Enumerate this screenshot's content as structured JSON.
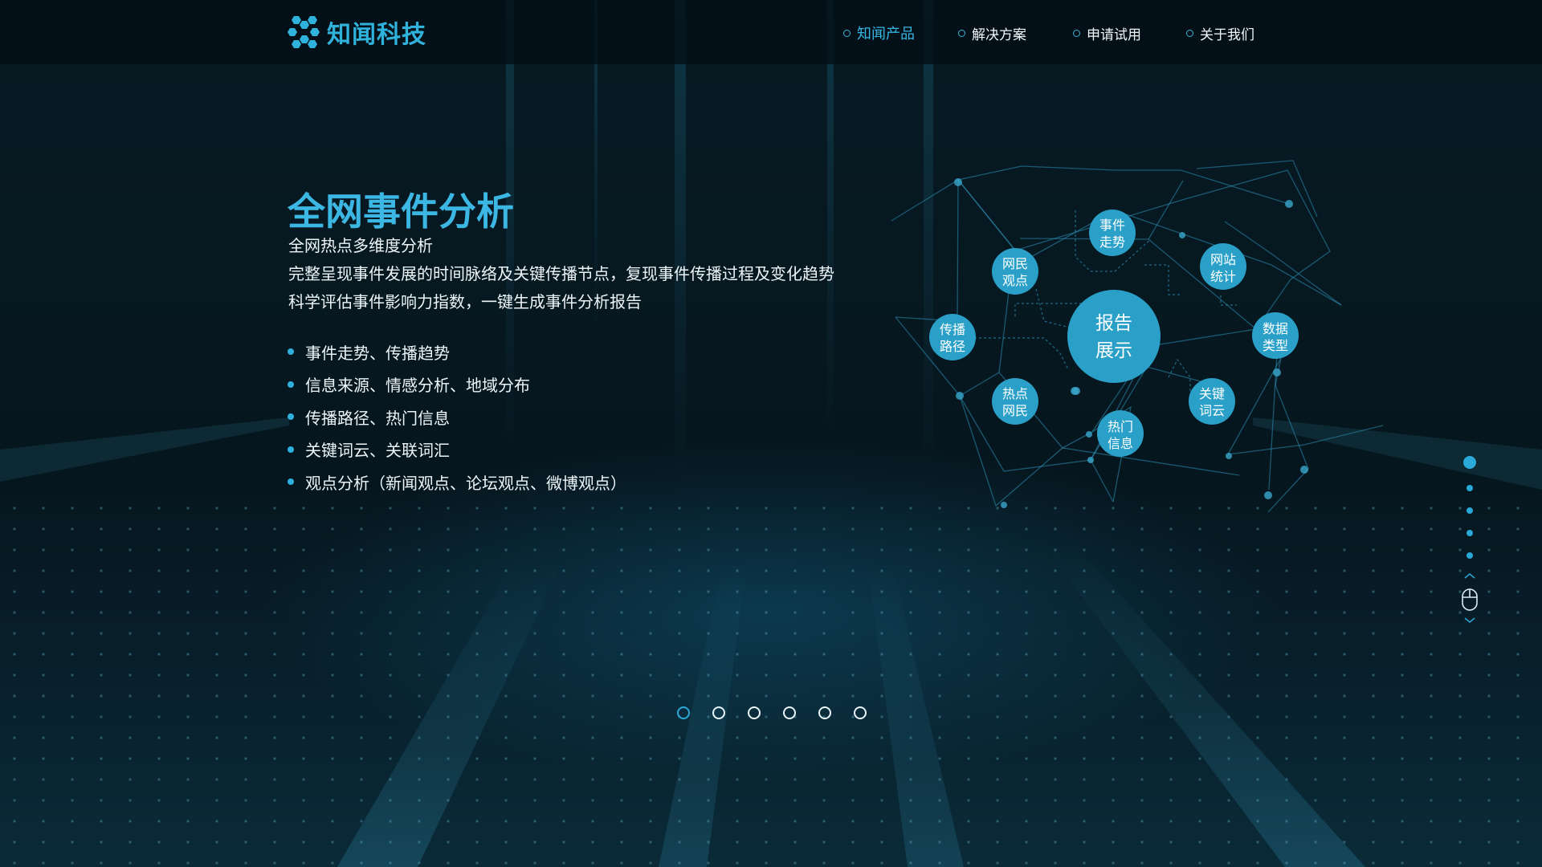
{
  "colors": {
    "accent": "#36b7e3",
    "node_fill": "#2aa0c8",
    "background": "#06141c",
    "text": "#eef6fa"
  },
  "header": {
    "logo_text": "知闻科技",
    "logo_icon": "hexagon-cluster-icon",
    "nav": [
      {
        "label": "知闻产品",
        "active": true
      },
      {
        "label": "解决方案",
        "active": false
      },
      {
        "label": "申请试用",
        "active": false
      },
      {
        "label": "关于我们",
        "active": false
      }
    ]
  },
  "hero": {
    "title": "全网事件分析",
    "subtitle": "全网热点多维度分析",
    "description": [
      "完整呈现事件发展的时间脉络及关键传播节点，复现事件传播过程及变化趋势",
      "科学评估事件影响力指数，一键生成事件分析报告"
    ],
    "features": [
      "事件走势、传播趋势",
      "信息来源、情感分析、地域分布",
      "传播路径、热门信息",
      "关键词云、关联词汇",
      "观点分析（新闻观点、论坛观点、微博观点）"
    ]
  },
  "diagram": {
    "center": [
      "报告",
      "展示"
    ],
    "nodes": [
      [
        "事件",
        "走势"
      ],
      [
        "网站",
        "统计"
      ],
      [
        "数据",
        "类型"
      ],
      [
        "关键",
        "词云"
      ],
      [
        "热门",
        "信息"
      ],
      [
        "热点",
        "网民"
      ],
      [
        "传播",
        "路径"
      ],
      [
        "网民",
        "观点"
      ]
    ]
  },
  "side_indicator": {
    "page_count": 5,
    "active_index": 0,
    "icon": "mouse-scroll-icon"
  },
  "carousel": {
    "slide_count": 6,
    "active_index": 0
  }
}
